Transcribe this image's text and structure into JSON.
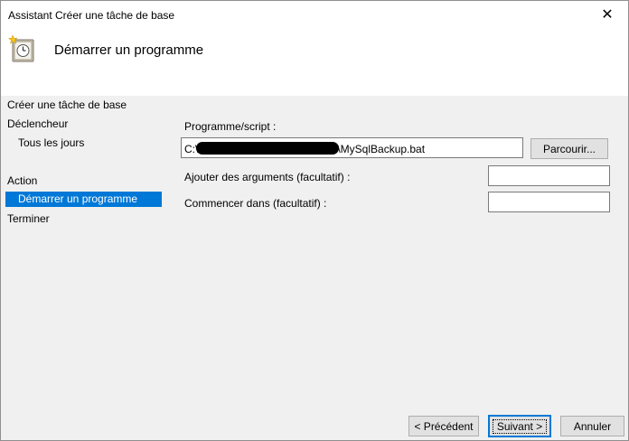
{
  "window": {
    "title": "Assistant Créer une tâche de base",
    "close_glyph": "✕"
  },
  "header": {
    "title": "Démarrer un programme",
    "icon": "task-clock-icon"
  },
  "nav": {
    "items": [
      {
        "label": "Créer une tâche de base"
      },
      {
        "label": "Déclencheur"
      },
      {
        "label": "Tous les jours"
      },
      {
        "label": "Action"
      },
      {
        "label": "Démarrer un programme"
      },
      {
        "label": "Terminer"
      }
    ],
    "selected_color": "#0078d7"
  },
  "form": {
    "program_label": "Programme/script :",
    "program_value_prefix": "C:\\",
    "program_value_suffix": "\\MySqlBackup.bat",
    "browse_label": "Parcourir...",
    "arguments_label": "Ajouter des arguments (facultatif) :",
    "arguments_value": "",
    "startin_label": "Commencer dans (facultatif) :",
    "startin_value": ""
  },
  "footer": {
    "back_label": "< Précédent",
    "next_label": "Suivant >",
    "cancel_label": "Annuler"
  }
}
